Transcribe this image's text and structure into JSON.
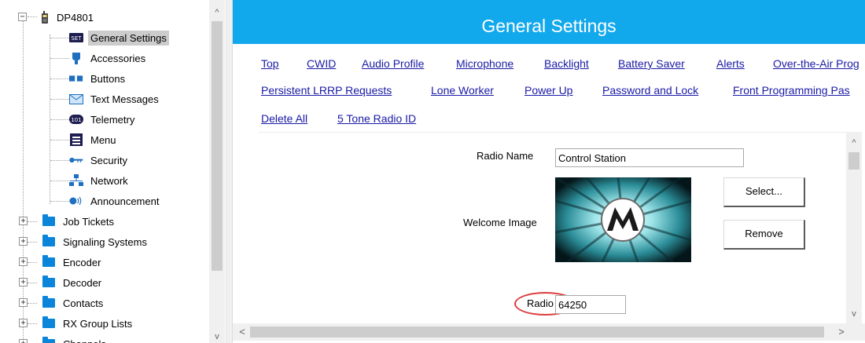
{
  "tree": {
    "root": {
      "label": "DP4801",
      "icon": "radio-device-icon",
      "expander": "⊟"
    },
    "items": [
      {
        "label": "General Settings",
        "icon": "set-badge-icon",
        "selected": true
      },
      {
        "label": "Accessories",
        "icon": "accessory-icon"
      },
      {
        "label": "Buttons",
        "icon": "buttons-icon"
      },
      {
        "label": "Text Messages",
        "icon": "envelope-icon"
      },
      {
        "label": "Telemetry",
        "icon": "telemetry-icon"
      },
      {
        "label": "Menu",
        "icon": "menu-icon"
      },
      {
        "label": "Security",
        "icon": "key-icon"
      },
      {
        "label": "Network",
        "icon": "network-icon"
      },
      {
        "label": "Announcement",
        "icon": "speaker-icon"
      },
      {
        "label": "Job Tickets",
        "icon": "folder-icon",
        "expander": "+"
      },
      {
        "label": "Signaling Systems",
        "icon": "folder-icon",
        "expander": "+"
      },
      {
        "label": "Encoder",
        "icon": "folder-icon",
        "expander": "+"
      },
      {
        "label": "Decoder",
        "icon": "folder-icon",
        "expander": "+"
      },
      {
        "label": "Contacts",
        "icon": "folder-icon",
        "expander": "+"
      },
      {
        "label": "RX Group Lists",
        "icon": "folder-icon",
        "expander": "+"
      },
      {
        "label": "Channels",
        "icon": "folder-icon",
        "expander": "+"
      }
    ],
    "scroll_up": "^",
    "scroll_down": "v"
  },
  "header": {
    "title": "General Settings"
  },
  "nav": {
    "row1": [
      "Top",
      "CWID",
      "Audio Profile",
      "Microphone",
      "Backlight",
      "Battery Saver",
      "Alerts",
      "Over-the-Air Prog"
    ],
    "row2": [
      "Persistent LRRP Requests",
      "Lone Worker",
      "Power Up",
      "Password and Lock",
      "Front Programming Pas"
    ],
    "row3": [
      "Delete All",
      "5 Tone Radio ID"
    ]
  },
  "form": {
    "radio_name_label": "Radio Name",
    "radio_name_value": "Control Station",
    "welcome_image_label": "Welcome Image",
    "select_button": "Select...",
    "remove_button": "Remove",
    "radio_id_label": "Radio ID",
    "radio_id_value": "64250"
  },
  "scrollbars": {
    "up": "^",
    "down": "v",
    "left": "<",
    "right": ">"
  },
  "colors": {
    "header_bg": "#11a8ec",
    "link": "#1a1aa6",
    "highlight_ring": "#dc3c3c",
    "folder": "#0a85d9"
  }
}
